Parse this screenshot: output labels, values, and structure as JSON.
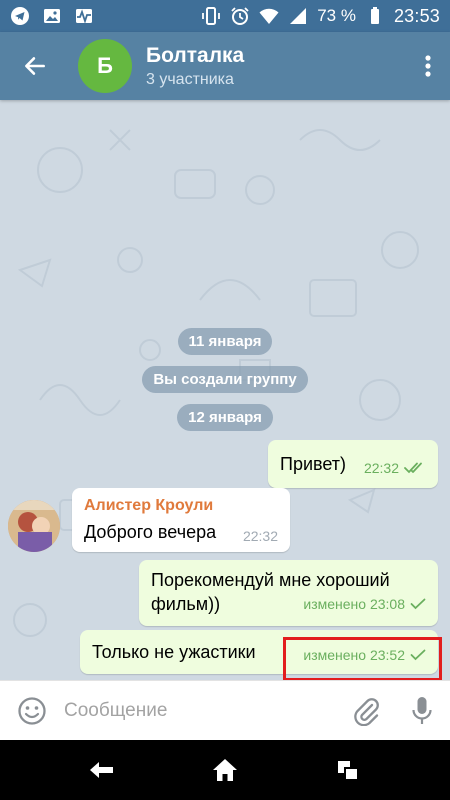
{
  "status_bar": {
    "left_icons": [
      "telegram-icon",
      "image-icon",
      "activity-icon"
    ],
    "battery": "73 %",
    "time": "23:53",
    "right_icons": [
      "vibrate-icon",
      "alarm-icon",
      "wifi-icon",
      "signal-icon",
      "battery-icon"
    ]
  },
  "header": {
    "avatar_letter": "Б",
    "title": "Болталка",
    "subtitle": "3 участника",
    "avatar_color": "#65b840",
    "bar_color": "#5682a3"
  },
  "chat": {
    "service_messages": [
      "11 января",
      "Вы создали группу",
      "12 января"
    ],
    "messages": [
      {
        "direction": "out",
        "text": "Привет)",
        "time": "22:32",
        "status": "read"
      },
      {
        "direction": "in",
        "sender": "Алистер Кроули",
        "text": "Доброго вечера",
        "time": "22:32"
      },
      {
        "direction": "out",
        "text_line1": "Порекомендуй мне хороший",
        "text_line2": "фильм))",
        "time": "изменено 23:08",
        "status": "sent"
      },
      {
        "direction": "out",
        "text": "Только не ужастики",
        "time": "изменено 23:52",
        "status": "sent"
      }
    ]
  },
  "input": {
    "placeholder": "Сообщение"
  },
  "colors": {
    "outgoing_bubble": "#effdde",
    "incoming_bubble": "#ffffff",
    "sender_name": "#e07a3c",
    "highlight_box": "#e21d1d"
  }
}
